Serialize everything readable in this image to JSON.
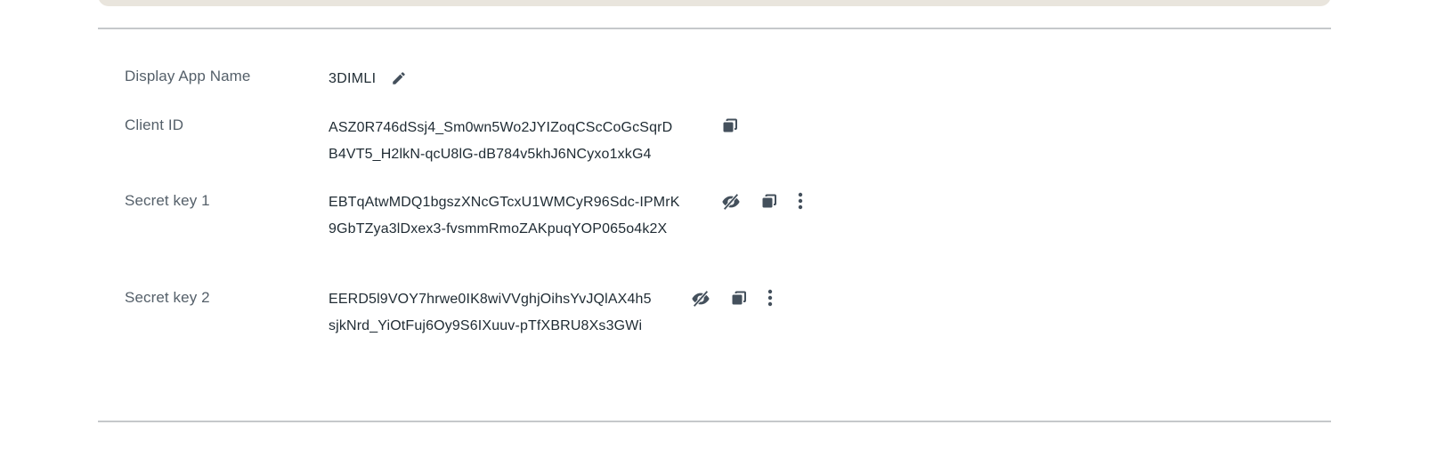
{
  "credentials": {
    "display_app_name": {
      "label": "Display App Name",
      "value": "3DIMLI",
      "edit_icon": "pencil-icon"
    },
    "client_id": {
      "label": "Client ID",
      "line1": "ASZ0R746dSsj4_Sm0wn5Wo2JYIZoqCScCoGcSqrD",
      "line2": "B4VT5_H2lkN-qcU8lG-dB784v5khJ6NCyxo1xkG4",
      "copy_icon": "copy-icon"
    },
    "secret_key_1": {
      "label": "Secret key 1",
      "line1": "EBTqAtwMDQ1bgszXNcGTcxU1WMCyR96Sdc-IPMrK",
      "line2": "9GbTZya3lDxex3-fvsmmRmoZAKpuqYOP065o4k2X",
      "icons": [
        "eye-off-icon",
        "copy-icon",
        "more-vertical-icon"
      ]
    },
    "secret_key_2": {
      "label": "Secret key 2",
      "line1": "EERD5l9VOY7hrwe0IK8wiVVghjOihsYvJQlAX4h5",
      "line2": "sjkNrd_YiOtFuj6Oy9S6IXuuv-pTfXBRU8Xs3GWi",
      "icons": [
        "eye-off-icon",
        "copy-icon",
        "more-vertical-icon"
      ]
    }
  },
  "colors": {
    "label": "#55606a",
    "value": "#1f2b33",
    "icon": "#44505c",
    "divider": "#c5c8cb",
    "top_panel": "#e9e5dd"
  }
}
